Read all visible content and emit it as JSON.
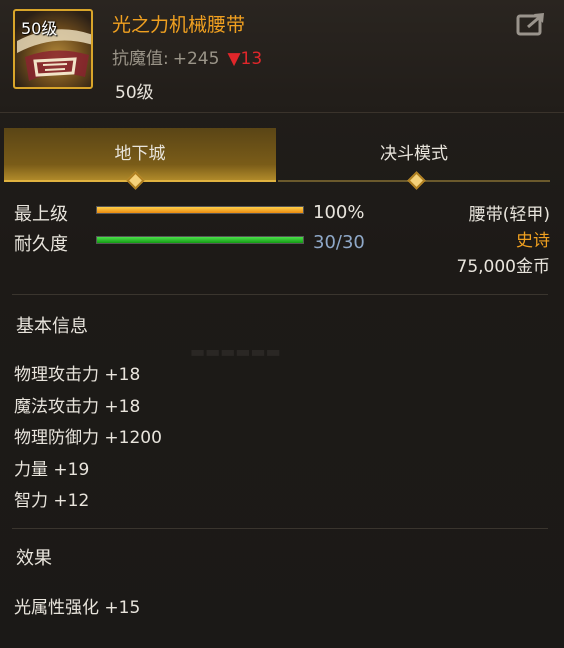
{
  "item": {
    "icon_name": "mechanical-belt-icon",
    "icon_level": "50级",
    "name": "光之力机械腰带",
    "stat_label": "抗魔值:",
    "stat_value": "+245",
    "stat_change": "▼13",
    "required_level": "50级",
    "name_color": "#f0a020"
  },
  "tabs": [
    {
      "label": "地下城",
      "active": true
    },
    {
      "label": "决斗模式",
      "active": false
    }
  ],
  "bars": {
    "level": {
      "label": "最上级",
      "value": "100%",
      "fraction": 1.0
    },
    "durability": {
      "label": "耐久度",
      "value": "30/30",
      "fraction": 1.0
    }
  },
  "meta": {
    "type": "腰带(轻甲)",
    "rarity": "史诗",
    "price": "75,000金币",
    "rarity_color": "#f0a020"
  },
  "basic_info": {
    "title": "基本信息",
    "attributes": [
      "物理攻击力 +18",
      "魔法攻击力 +18",
      "物理防御力 +1200",
      "力量 +19",
      "智力 +12"
    ]
  },
  "effects": {
    "title": "效果",
    "lines": [
      "光属性强化 +15"
    ]
  }
}
